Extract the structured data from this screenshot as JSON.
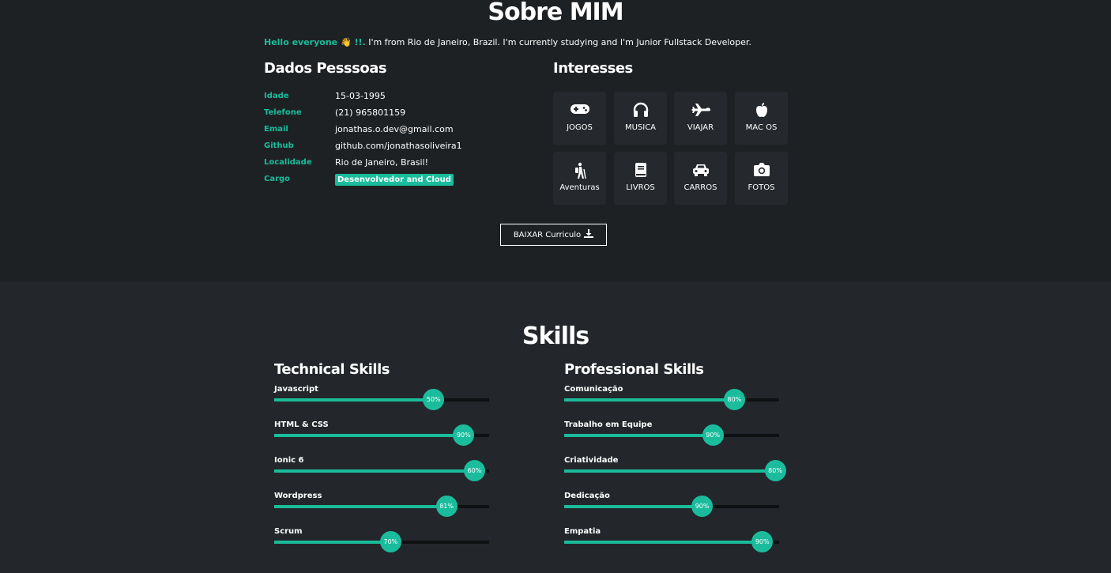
{
  "about": {
    "title": "Sobre MIM",
    "intro_highlight": "Hello everyone 👋 !!.",
    "intro_text": " I'm from Rio de Janeiro, Brazil. I'm currently studying and I'm Junior Fullstack Developer.",
    "personal_heading": "Dados Pesssoas",
    "interests_heading": "Interesses",
    "info": [
      {
        "label": "Idade",
        "value": "15-03-1995"
      },
      {
        "label": "Telefone",
        "value": "(21) 965801159"
      },
      {
        "label": "Email",
        "value": "jonathas.o.dev@gmail.com"
      },
      {
        "label": "Github",
        "value": "github.com/jonathasoliveira1"
      },
      {
        "label": "Localidade",
        "value": "Rio de Janeiro, Brasil!"
      },
      {
        "label": "Cargo",
        "value": "Desenvolvedor and Cloud"
      }
    ],
    "interests": [
      {
        "label": "JOGOS",
        "icon": "gamepad-icon"
      },
      {
        "label": "MUSICA",
        "icon": "headphones-icon"
      },
      {
        "label": "VIAJAR",
        "icon": "plane-icon"
      },
      {
        "label": "MAC OS",
        "icon": "apple-icon"
      },
      {
        "label": "Aventuras",
        "icon": "hiker-icon"
      },
      {
        "label": "LIVROS",
        "icon": "book-icon"
      },
      {
        "label": "CARROS",
        "icon": "car-icon"
      },
      {
        "label": "FOTOS",
        "icon": "camera-icon"
      }
    ],
    "download_label": "BAIXAR Curriculo"
  },
  "skills": {
    "title": "Skills",
    "technical_heading": "Technical Skills",
    "professional_heading": "Professional Skills",
    "technical": [
      {
        "name": "Javascript",
        "label": "50%",
        "fill": 0.74
      },
      {
        "name": "HTML & CSS",
        "label": "90%",
        "fill": 0.88
      },
      {
        "name": "Ionic 6",
        "label": "60%",
        "fill": 0.93
      },
      {
        "name": "Wordpress",
        "label": "81%",
        "fill": 0.8
      },
      {
        "name": "Scrum",
        "label": "70%",
        "fill": 0.54
      }
    ],
    "professional": [
      {
        "name": "Comunicação",
        "label": "80%",
        "fill": 0.79
      },
      {
        "name": "Trabalho em Equipe",
        "label": "90%",
        "fill": 0.69
      },
      {
        "name": "Criatividade",
        "label": "80%",
        "fill": 0.98
      },
      {
        "name": "Dedicação",
        "label": "90%",
        "fill": 0.64
      },
      {
        "name": "Empatia",
        "label": "90%",
        "fill": 0.92
      }
    ]
  },
  "colors": {
    "accent": "#1abc9c",
    "bg_top": "#1e2124",
    "bg_bottom": "#23272b"
  }
}
